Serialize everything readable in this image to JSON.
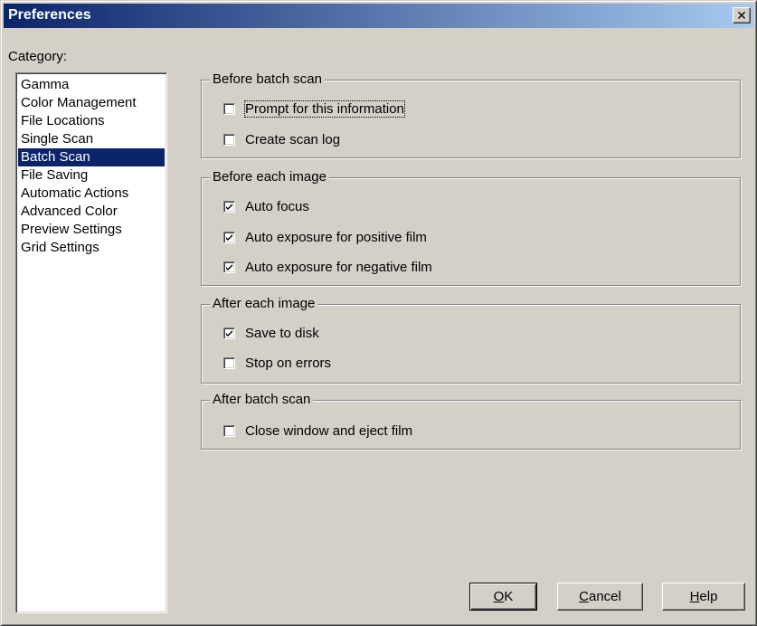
{
  "window": {
    "title": "Preferences",
    "close_glyph": "✕"
  },
  "category": {
    "label": "Category:",
    "items": [
      {
        "label": "Gamma",
        "selected": false
      },
      {
        "label": "Color Management",
        "selected": false
      },
      {
        "label": "File Locations",
        "selected": false
      },
      {
        "label": "Single Scan",
        "selected": false
      },
      {
        "label": "Batch Scan",
        "selected": true
      },
      {
        "label": "File Saving",
        "selected": false
      },
      {
        "label": "Automatic Actions",
        "selected": false
      },
      {
        "label": "Advanced Color",
        "selected": false
      },
      {
        "label": "Preview Settings",
        "selected": false
      },
      {
        "label": "Grid Settings",
        "selected": false
      }
    ]
  },
  "groups": {
    "before_batch": {
      "legend": "Before batch scan",
      "options": [
        {
          "label": "Prompt for this information",
          "checked": false
        },
        {
          "label": "Create scan log",
          "checked": false
        }
      ]
    },
    "before_each": {
      "legend": "Before each image",
      "options": [
        {
          "label": "Auto focus",
          "checked": true
        },
        {
          "label": "Auto exposure for positive film",
          "checked": true
        },
        {
          "label": "Auto exposure for negative film",
          "checked": true
        }
      ]
    },
    "after_each": {
      "legend": "After each image",
      "options": [
        {
          "label": "Save to disk",
          "checked": true
        },
        {
          "label": "Stop on errors",
          "checked": false
        }
      ]
    },
    "after_batch": {
      "legend": "After batch scan",
      "options": [
        {
          "label": "Close window and eject film",
          "checked": false
        }
      ]
    }
  },
  "buttons": {
    "ok": {
      "accel": "O",
      "rest": "K"
    },
    "cancel": {
      "accel": "C",
      "rest": "ancel"
    },
    "help": {
      "accel": "H",
      "rest": "elp"
    }
  },
  "colors": {
    "title_gradient_start": "#0a246a",
    "title_gradient_end": "#a6caf0",
    "dialog_face": "#d4d0c8",
    "selection": "#0a246a"
  }
}
